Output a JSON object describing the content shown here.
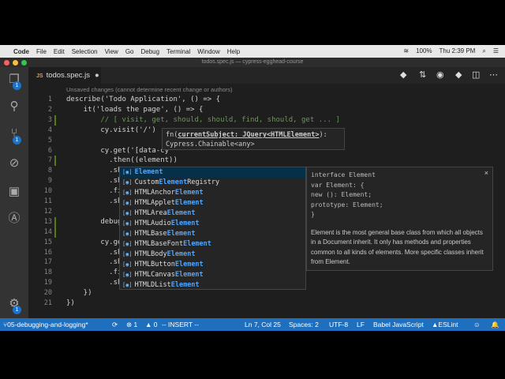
{
  "menubar": {
    "app": "Code",
    "items": [
      "File",
      "Edit",
      "Selection",
      "View",
      "Go",
      "Debug",
      "Terminal",
      "Window",
      "Help"
    ],
    "battery": "100%",
    "clock": "Thu 2:39 PM"
  },
  "window": {
    "title": "todos.spec.js — cypress-egghead-course"
  },
  "activity": {
    "explorer_badge": "1",
    "scm_badge": "1",
    "settings_badge": "1"
  },
  "tab": {
    "icon": "JS",
    "label": "todos.spec.js"
  },
  "editor": {
    "blame": "Unsaved changes (cannot determine recent change or authors)",
    "line_numbers": [
      "1",
      "2",
      "3",
      "4",
      "5",
      "6",
      "7",
      "8",
      "9",
      "10",
      "11",
      "12",
      "13",
      "14",
      "15",
      "16",
      "17",
      "18",
      "19",
      "20",
      "21"
    ],
    "lines": [
      "describe('Todo Application', () => {",
      "    it('loads the page', () => {",
      "        // [ visit, get, should, should, find, should, get ... ]",
      "        cy.visit('/')",
      "",
      "        cy.get('[data-cy",
      "          .then((element))",
      "          .sh",
      "          .sh",
      "          .fi",
      "          .sh",
      "",
      "        debug",
      "",
      "        cy.ge",
      "          .sh",
      "          .sh",
      "          .fi",
      "          .sh",
      "    })",
      "})"
    ]
  },
  "hover": {
    "prefix": "fn(",
    "param": "currentSubject: JQuery<HTMLElement>",
    "suffix": "):",
    "return": "Cypress.Chainable<any>"
  },
  "suggest": {
    "items": [
      {
        "pre": "",
        "match": "Element",
        "post": ""
      },
      {
        "pre": "Custom",
        "match": "Element",
        "post": "Registry"
      },
      {
        "pre": "HTMLAnchor",
        "match": "Element",
        "post": ""
      },
      {
        "pre": "HTMLApplet",
        "match": "Element",
        "post": ""
      },
      {
        "pre": "HTMLArea",
        "match": "Element",
        "post": ""
      },
      {
        "pre": "HTMLAudio",
        "match": "Element",
        "post": ""
      },
      {
        "pre": "HTMLBase",
        "match": "Element",
        "post": ""
      },
      {
        "pre": "HTMLBaseFont",
        "match": "Element",
        "post": ""
      },
      {
        "pre": "HTMLBody",
        "match": "Element",
        "post": ""
      },
      {
        "pre": "HTMLButton",
        "match": "Element",
        "post": ""
      },
      {
        "pre": "HTMLCanvas",
        "match": "Element",
        "post": ""
      },
      {
        "pre": "HTMLDList",
        "match": "Element",
        "post": ""
      }
    ]
  },
  "details": {
    "sig": [
      "interface Element",
      "var Element: {",
      "new (): Element;",
      "prototype: Element;",
      "}"
    ],
    "doc": "Element is the most general base class from which all objects in a Document inherit. It only has methods and properties common to all kinds of elements. More specific classes inherit from Element.",
    "close": "×"
  },
  "status": {
    "branch": "05-debugging-and-logging*",
    "sync": "⟳",
    "errors": "⊗ 1",
    "warnings": "▲ 0",
    "mode": "-- INSERT --",
    "position": "Ln 7, Col 25",
    "spaces": "Spaces: 2",
    "encoding": "UTF-8",
    "eol": "LF",
    "language": "Babel JavaScript",
    "eslint": "ESLint"
  },
  "colors": {
    "statusbar": "#1f6fbf",
    "editor_bg": "#1e1e1e",
    "accent": "#4fa6ff"
  }
}
